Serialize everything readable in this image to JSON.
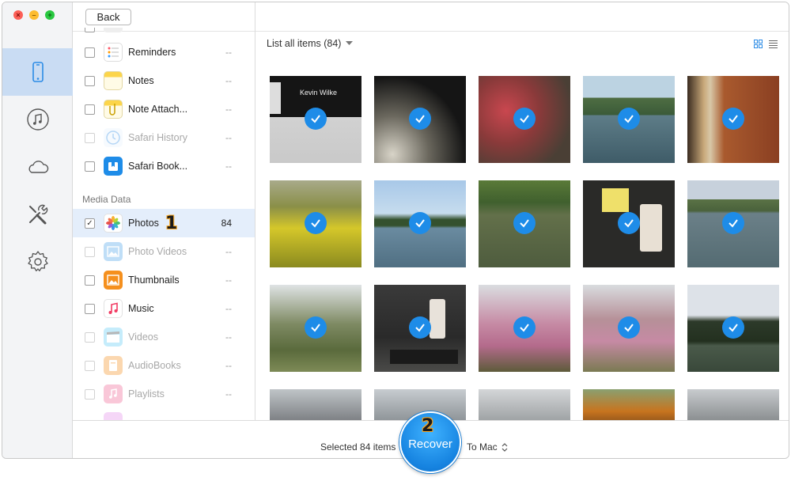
{
  "window": {
    "controls": [
      "close",
      "minimize",
      "zoom"
    ],
    "close_glyph": "×",
    "minimize_glyph": "–",
    "zoom_glyph": "+"
  },
  "sidebar": {
    "items": [
      {
        "name": "device-icon",
        "active": true
      },
      {
        "name": "music-icon",
        "active": false
      },
      {
        "name": "cloud-icon",
        "active": false
      },
      {
        "name": "tools-icon",
        "active": false
      },
      {
        "name": "settings-icon",
        "active": false
      }
    ]
  },
  "toolbar": {
    "back_label": "Back"
  },
  "categories": {
    "items": [
      {
        "label": "Reminders",
        "count": "--",
        "checked": false,
        "disabled": false,
        "icon": "reminders-icon"
      },
      {
        "label": "Notes",
        "count": "--",
        "checked": false,
        "disabled": false,
        "icon": "notes-icon"
      },
      {
        "label": "Note Attach...",
        "count": "--",
        "checked": false,
        "disabled": false,
        "icon": "note-attachments-icon"
      },
      {
        "label": "Safari History",
        "count": "--",
        "checked": false,
        "disabled": true,
        "icon": "safari-history-icon"
      },
      {
        "label": "Safari Book...",
        "count": "--",
        "checked": false,
        "disabled": false,
        "icon": "safari-bookmarks-icon"
      }
    ],
    "media_section_label": "Media Data",
    "media_items": [
      {
        "label": "Photos",
        "count": "84",
        "checked": true,
        "disabled": false,
        "icon": "photos-icon"
      },
      {
        "label": "Photo Videos",
        "count": "--",
        "checked": false,
        "disabled": true,
        "icon": "photo-videos-icon"
      },
      {
        "label": "Thumbnails",
        "count": "--",
        "checked": false,
        "disabled": false,
        "icon": "thumbnails-icon"
      },
      {
        "label": "Music",
        "count": "--",
        "checked": false,
        "disabled": false,
        "icon": "music-note-icon"
      },
      {
        "label": "Videos",
        "count": "--",
        "checked": false,
        "disabled": true,
        "icon": "videos-icon"
      },
      {
        "label": "AudioBooks",
        "count": "--",
        "checked": false,
        "disabled": true,
        "icon": "audiobooks-icon"
      },
      {
        "label": "Playlists",
        "count": "--",
        "checked": false,
        "disabled": true,
        "icon": "playlists-icon"
      }
    ],
    "step_marker": "1",
    "check_glyph": "✓"
  },
  "content": {
    "list_label": "List all items (84)",
    "view_modes": [
      "grid-view-icon",
      "list-view-icon"
    ],
    "first_thumb_text": "Kevin Wilke",
    "photo_count_rows": 4
  },
  "bottom": {
    "selected_text": "Selected 84 items",
    "recover_label": "Recover",
    "recover_step": "2",
    "destination": "To Mac"
  },
  "colors": {
    "accent": "#1e8ce8",
    "sidebar_active": "#c9dcf3",
    "selected_row": "#e4eefb",
    "step_marker": "#f6a623"
  }
}
